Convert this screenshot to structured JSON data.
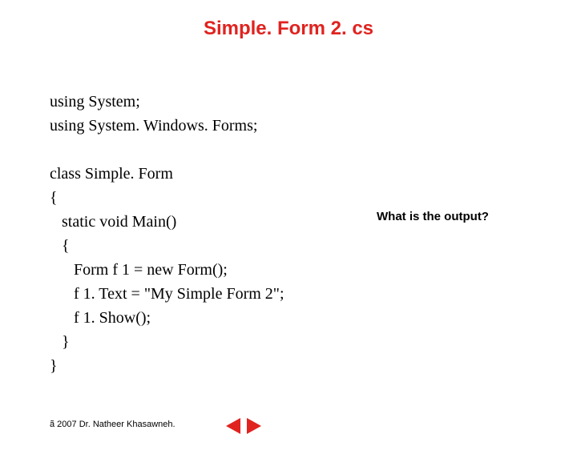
{
  "title": "Simple. Form 2. cs",
  "code_lines": [
    "using System;",
    "using System. Windows. Forms;",
    "",
    "class Simple. Form",
    "{",
    "   static void Main()",
    "   {",
    "      Form f 1 = new Form();",
    "      f 1. Text = \"My Simple Form 2\";",
    "      f 1. Show();",
    "   }",
    "}"
  ],
  "question": "What is the output?",
  "footer": "ã 2007 Dr. Natheer Khasawneh.",
  "nav": {
    "prev": "previous-slide",
    "next": "next-slide"
  }
}
